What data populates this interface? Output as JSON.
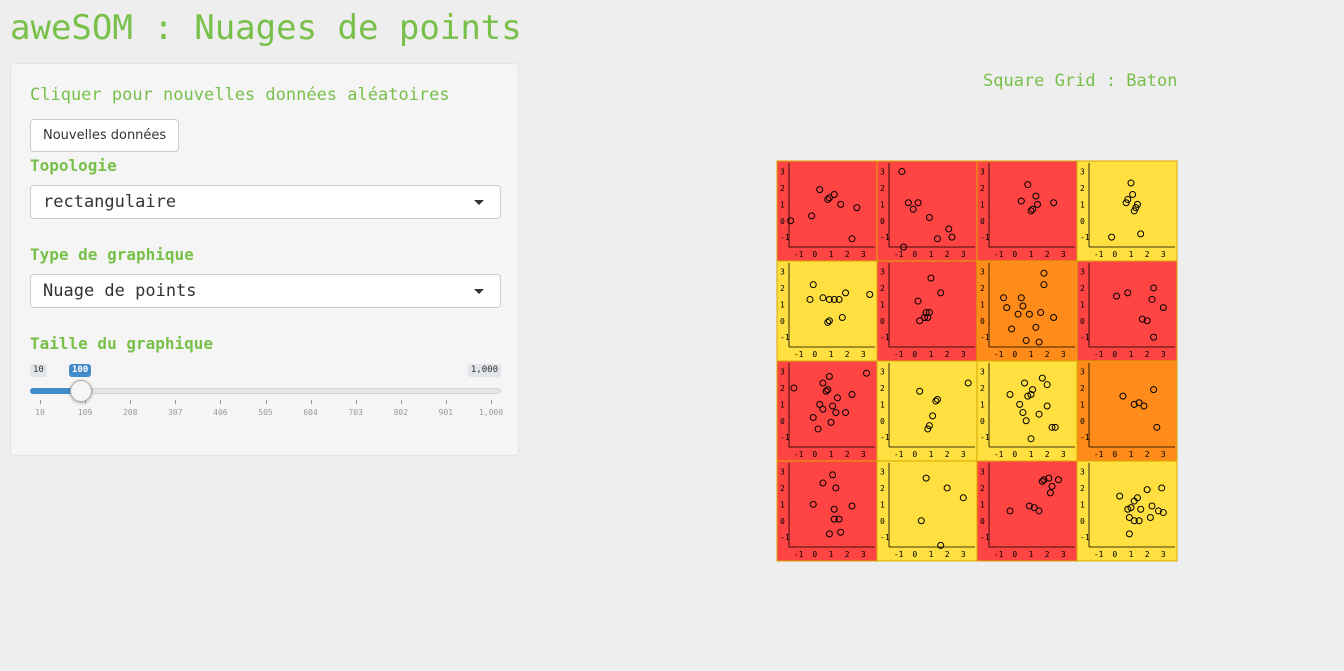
{
  "app": {
    "title": "aweSOM : Nuages de points"
  },
  "sidebar": {
    "intro_text": "Cliquer pour nouvelles données aléatoires",
    "new_data_button": "Nouvelles données",
    "topology": {
      "label": "Topologie",
      "selected": "rectangulaire"
    },
    "plot_type": {
      "label": "Type de graphique",
      "selected": "Nuage de points"
    },
    "plot_size": {
      "label": "Taille du graphique",
      "min": "10",
      "max": "1,000",
      "value": "100",
      "value_num": 100,
      "min_num": 10,
      "max_num": 1000,
      "ticks": [
        "10",
        "109",
        "208",
        "307",
        "406",
        "505",
        "604",
        "703",
        "802",
        "901",
        "1,000"
      ]
    }
  },
  "plot": {
    "title": "Square Grid : Baton",
    "colors": {
      "red": "#ff4444",
      "yellow": "#ffe040",
      "orange": "#ff8c1a",
      "border": "#d9a800"
    }
  },
  "chart_data": {
    "type": "scatter",
    "layout": "4x4 grid of scatter cells",
    "x_ticks": [
      "-1",
      "0",
      "1",
      "2",
      "3"
    ],
    "y_ticks": [
      "3",
      "2",
      "1",
      "0",
      "-1"
    ],
    "xlim": [
      -1.6,
      3.6
    ],
    "ylim": [
      -1.6,
      3.4
    ],
    "cells": [
      {
        "row": 0,
        "col": 0,
        "color": "red",
        "points": [
          [
            -1.5,
            0
          ],
          [
            -0.2,
            0.3
          ],
          [
            0.3,
            1.9
          ],
          [
            0.8,
            1.3
          ],
          [
            0.9,
            1.4
          ],
          [
            1.2,
            1.6
          ],
          [
            1.6,
            1.0
          ],
          [
            2.3,
            -1.1
          ],
          [
            2.6,
            0.8
          ]
        ]
      },
      {
        "row": 0,
        "col": 1,
        "color": "red",
        "points": [
          [
            -0.8,
            3.0
          ],
          [
            -0.7,
            -1.6
          ],
          [
            -0.4,
            1.1
          ],
          [
            -0.1,
            0.7
          ],
          [
            0.2,
            1.1
          ],
          [
            0.9,
            0.2
          ],
          [
            1.4,
            -1.1
          ],
          [
            2.1,
            -0.5
          ],
          [
            2.3,
            -1.0
          ]
        ]
      },
      {
        "row": 0,
        "col": 2,
        "color": "red",
        "points": [
          [
            0.4,
            1.2
          ],
          [
            0.8,
            2.2
          ],
          [
            1.0,
            0.6
          ],
          [
            1.1,
            0.7
          ],
          [
            1.3,
            1.5
          ],
          [
            1.4,
            1.0
          ],
          [
            2.4,
            1.1
          ]
        ]
      },
      {
        "row": 0,
        "col": 3,
        "color": "yellow",
        "points": [
          [
            -0.2,
            -1.0
          ],
          [
            0.7,
            1.1
          ],
          [
            0.8,
            1.3
          ],
          [
            1.0,
            2.3
          ],
          [
            1.1,
            1.6
          ],
          [
            1.2,
            0.6
          ],
          [
            1.3,
            0.8
          ],
          [
            1.4,
            1.0
          ],
          [
            1.6,
            -0.8
          ]
        ]
      },
      {
        "row": 1,
        "col": 0,
        "color": "yellow",
        "points": [
          [
            -0.3,
            1.3
          ],
          [
            -0.1,
            2.2
          ],
          [
            0.5,
            1.4
          ],
          [
            0.8,
            -0.1
          ],
          [
            0.9,
            0.0
          ],
          [
            0.9,
            1.3
          ],
          [
            1.2,
            1.3
          ],
          [
            1.5,
            1.3
          ],
          [
            1.7,
            0.2
          ],
          [
            1.9,
            1.7
          ],
          [
            3.4,
            1.6
          ]
        ]
      },
      {
        "row": 1,
        "col": 1,
        "color": "red",
        "points": [
          [
            0.2,
            1.2
          ],
          [
            0.3,
            0.0
          ],
          [
            0.6,
            0.2
          ],
          [
            0.7,
            0.5
          ],
          [
            0.8,
            0.2
          ],
          [
            0.9,
            0.5
          ],
          [
            1.0,
            2.6
          ],
          [
            1.6,
            1.7
          ]
        ]
      },
      {
        "row": 1,
        "col": 2,
        "color": "orange",
        "points": [
          [
            -0.7,
            1.4
          ],
          [
            -0.5,
            0.8
          ],
          [
            -0.2,
            -0.5
          ],
          [
            0.2,
            0.4
          ],
          [
            0.4,
            1.4
          ],
          [
            0.5,
            0.9
          ],
          [
            0.7,
            -1.2
          ],
          [
            0.9,
            0.4
          ],
          [
            1.3,
            -0.4
          ],
          [
            1.5,
            -1.3
          ],
          [
            1.6,
            0.5
          ],
          [
            1.8,
            2.2
          ],
          [
            1.8,
            2.9
          ],
          [
            2.4,
            0.2
          ]
        ]
      },
      {
        "row": 1,
        "col": 3,
        "color": "red",
        "points": [
          [
            0.1,
            1.5
          ],
          [
            0.8,
            1.7
          ],
          [
            1.7,
            0.1
          ],
          [
            2.0,
            0.0
          ],
          [
            2.3,
            1.3
          ],
          [
            2.4,
            -1.0
          ],
          [
            2.4,
            2.0
          ],
          [
            3.0,
            0.8
          ]
        ]
      },
      {
        "row": 2,
        "col": 0,
        "color": "red",
        "points": [
          [
            -1.3,
            2.0
          ],
          [
            -0.1,
            0.2
          ],
          [
            0.2,
            -0.5
          ],
          [
            0.3,
            1.0
          ],
          [
            0.5,
            0.7
          ],
          [
            0.5,
            2.3
          ],
          [
            0.7,
            1.8
          ],
          [
            0.8,
            1.9
          ],
          [
            0.9,
            2.7
          ],
          [
            1.0,
            -0.1
          ],
          [
            1.1,
            0.9
          ],
          [
            1.3,
            0.5
          ],
          [
            1.4,
            1.4
          ],
          [
            1.9,
            0.5
          ],
          [
            2.3,
            1.6
          ],
          [
            3.2,
            2.9
          ]
        ]
      },
      {
        "row": 2,
        "col": 1,
        "color": "yellow",
        "points": [
          [
            0.3,
            1.8
          ],
          [
            0.8,
            -0.5
          ],
          [
            0.9,
            -0.3
          ],
          [
            1.1,
            0.3
          ],
          [
            1.3,
            1.2
          ],
          [
            1.4,
            1.3
          ],
          [
            3.3,
            2.3
          ]
        ]
      },
      {
        "row": 2,
        "col": 2,
        "color": "yellow",
        "points": [
          [
            -0.3,
            1.6
          ],
          [
            0.3,
            1.0
          ],
          [
            0.5,
            0.5
          ],
          [
            0.6,
            2.3
          ],
          [
            0.7,
            0.0
          ],
          [
            0.8,
            1.5
          ],
          [
            1.0,
            1.6
          ],
          [
            1.0,
            -1.1
          ],
          [
            1.1,
            1.9
          ],
          [
            1.5,
            0.4
          ],
          [
            1.7,
            2.6
          ],
          [
            2.0,
            2.2
          ],
          [
            2.0,
            0.9
          ],
          [
            2.3,
            -0.4
          ],
          [
            2.5,
            -0.4
          ]
        ]
      },
      {
        "row": 2,
        "col": 3,
        "color": "orange",
        "points": [
          [
            0.5,
            1.5
          ],
          [
            1.2,
            1.0
          ],
          [
            1.5,
            1.1
          ],
          [
            1.8,
            0.9
          ],
          [
            2.4,
            1.9
          ],
          [
            2.6,
            -0.4
          ]
        ]
      },
      {
        "row": 3,
        "col": 0,
        "color": "red",
        "points": [
          [
            -0.1,
            1.0
          ],
          [
            0.5,
            2.3
          ],
          [
            0.9,
            -0.8
          ],
          [
            1.1,
            2.8
          ],
          [
            1.2,
            0.1
          ],
          [
            1.2,
            0.7
          ],
          [
            1.3,
            2.0
          ],
          [
            1.5,
            0.1
          ],
          [
            1.6,
            -0.7
          ],
          [
            2.3,
            0.9
          ]
        ]
      },
      {
        "row": 3,
        "col": 1,
        "color": "yellow",
        "points": [
          [
            0.4,
            0.0
          ],
          [
            0.7,
            2.6
          ],
          [
            1.6,
            -1.5
          ],
          [
            2.0,
            2.0
          ],
          [
            3.0,
            1.4
          ]
        ]
      },
      {
        "row": 3,
        "col": 2,
        "color": "red",
        "points": [
          [
            -0.3,
            0.6
          ],
          [
            0.9,
            0.9
          ],
          [
            1.2,
            0.8
          ],
          [
            1.5,
            0.6
          ],
          [
            1.7,
            2.4
          ],
          [
            1.8,
            2.5
          ],
          [
            2.1,
            2.6
          ],
          [
            2.2,
            1.7
          ],
          [
            2.3,
            2.1
          ],
          [
            2.7,
            2.5
          ]
        ]
      },
      {
        "row": 3,
        "col": 3,
        "color": "yellow",
        "points": [
          [
            0.3,
            1.5
          ],
          [
            0.8,
            0.7
          ],
          [
            0.9,
            0.2
          ],
          [
            0.9,
            -0.8
          ],
          [
            1.0,
            0.8
          ],
          [
            1.2,
            0.0
          ],
          [
            1.2,
            1.2
          ],
          [
            1.4,
            1.4
          ],
          [
            1.5,
            0.0
          ],
          [
            1.6,
            0.7
          ],
          [
            2.0,
            1.9
          ],
          [
            2.2,
            0.2
          ],
          [
            2.3,
            0.9
          ],
          [
            2.7,
            0.6
          ],
          [
            2.9,
            2.0
          ],
          [
            3.0,
            0.5
          ]
        ]
      }
    ]
  }
}
